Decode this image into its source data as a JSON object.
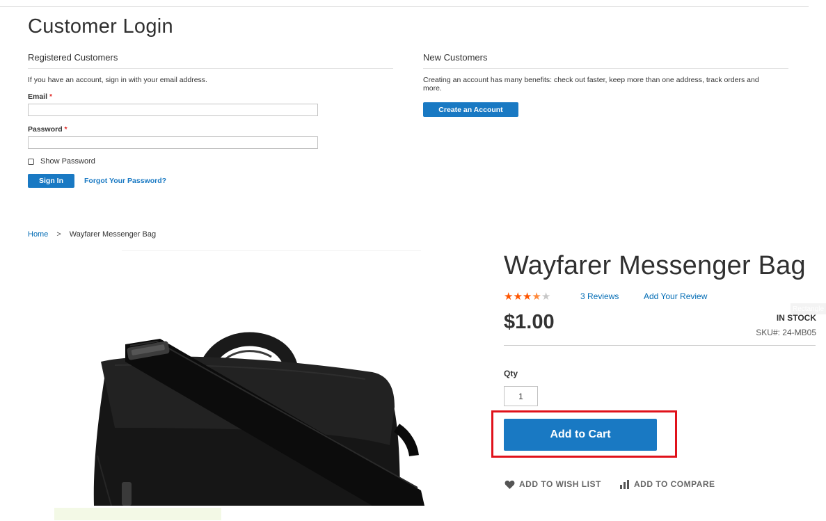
{
  "login": {
    "title": "Customer Login",
    "registered": {
      "heading": "Registered Customers",
      "intro": "If you have an account, sign in with your email address.",
      "email_label": "Email",
      "password_label": "Password",
      "required_mark": "*",
      "email_value": "",
      "password_value": "",
      "show_password_label": "Show Password",
      "sign_in_label": "Sign In",
      "forgot_label": "Forgot Your Password?"
    },
    "new_customers": {
      "heading": "New Customers",
      "intro": "Creating an account has many benefits: check out faster, keep more than one address, track orders and more.",
      "create_label": "Create an Account"
    }
  },
  "breadcrumb": {
    "home": "Home",
    "separator": ">",
    "current": "Wayfarer Messenger Bag"
  },
  "product": {
    "name": "Wayfarer Messenger Bag",
    "rating": {
      "value": 3.5,
      "max": 5
    },
    "reviews_label": "3  Reviews",
    "add_review_label": "Add Your Review",
    "compare_ghost": "Rectangle",
    "price": "$1.00",
    "stock": "IN STOCK",
    "sku": "SKU#:  24-MB05",
    "qty_label": "Qty",
    "qty_value": "1",
    "add_to_cart_label": "Add to Cart",
    "wishlist_label": "ADD TO WISH LIST",
    "compare_label": "ADD TO COMPARE"
  },
  "colors": {
    "primary": "#1979c3",
    "link": "#006bb4",
    "star_on": "#ff5501",
    "star_off": "#c7c7c7",
    "required": "#e02b27",
    "highlight": "#e0121b"
  },
  "icons": {
    "wishlist": "heart-icon",
    "compare": "bar-chart-icon",
    "rating": "star-icon"
  }
}
